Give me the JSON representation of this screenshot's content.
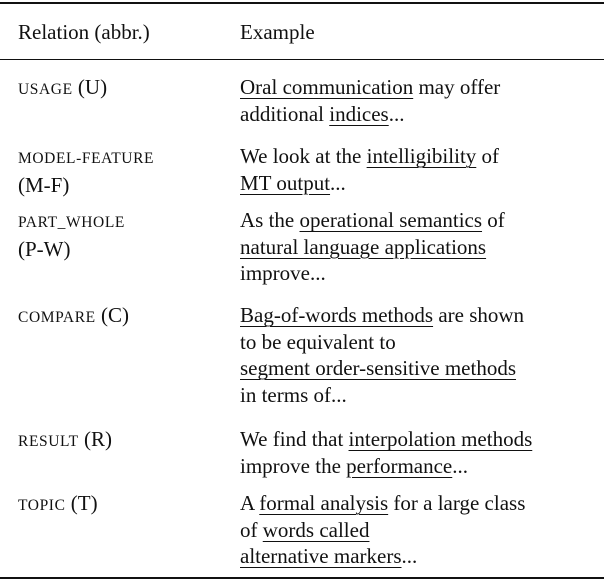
{
  "table": {
    "headers": {
      "relation": "Relation (abbr.)",
      "example": "Example"
    },
    "rows": [
      {
        "relation_name": "USAGE",
        "relation_abbr": "(U)",
        "abbr_on_new_line": false,
        "example_lines": [
          [
            {
              "text": "Oral communication",
              "underlined": true
            },
            {
              "text": " may offer",
              "underlined": false
            }
          ],
          [
            {
              "text": "additional ",
              "underlined": false
            },
            {
              "text": "indices",
              "underlined": true
            },
            {
              "text": "...",
              "underlined": false
            }
          ]
        ]
      },
      {
        "relation_name": "MODEL-FEATURE",
        "relation_abbr": "(M-F)",
        "abbr_on_new_line": true,
        "example_lines": [
          [
            {
              "text": "We look at the ",
              "underlined": false
            },
            {
              "text": "intelligibility",
              "underlined": true
            },
            {
              "text": " of",
              "underlined": false
            }
          ],
          [
            {
              "text": "MT output",
              "underlined": true
            },
            {
              "text": "...",
              "underlined": false
            }
          ]
        ]
      },
      {
        "relation_name": "PART_WHOLE",
        "relation_abbr": "(P-W)",
        "abbr_on_new_line": true,
        "example_lines": [
          [
            {
              "text": "As the ",
              "underlined": false
            },
            {
              "text": "operational semantics",
              "underlined": true
            },
            {
              "text": " of",
              "underlined": false
            }
          ],
          [
            {
              "text": "natural language applications",
              "underlined": true
            }
          ],
          [
            {
              "text": "improve...",
              "underlined": false
            }
          ]
        ]
      },
      {
        "relation_name": "COMPARE",
        "relation_abbr": "(C)",
        "abbr_on_new_line": false,
        "example_lines": [
          [
            {
              "text": "Bag-of-words methods",
              "underlined": true
            },
            {
              "text": " are shown",
              "underlined": false
            }
          ],
          [
            {
              "text": "to be equivalent to",
              "underlined": false
            }
          ],
          [
            {
              "text": "segment order-sensitive methods",
              "underlined": true
            }
          ],
          [
            {
              "text": "in terms of...",
              "underlined": false
            }
          ]
        ]
      },
      {
        "relation_name": "RESULT",
        "relation_abbr": "(R)",
        "abbr_on_new_line": false,
        "example_lines": [
          [
            {
              "text": "We find that ",
              "underlined": false
            },
            {
              "text": "interpolation methods",
              "underlined": true
            }
          ],
          [
            {
              "text": "improve the ",
              "underlined": false
            },
            {
              "text": "performance",
              "underlined": true
            },
            {
              "text": "...",
              "underlined": false
            }
          ]
        ]
      },
      {
        "relation_name": "TOPIC",
        "relation_abbr": "(T)",
        "abbr_on_new_line": false,
        "example_lines": [
          [
            {
              "text": "A ",
              "underlined": false
            },
            {
              "text": "formal analysis",
              "underlined": true
            },
            {
              "text": " for a large class",
              "underlined": false
            }
          ],
          [
            {
              "text": "of ",
              "underlined": false
            },
            {
              "text": "words called",
              "underlined": true
            }
          ],
          [
            {
              "text": "alternative markers",
              "underlined": true
            },
            {
              "text": "...",
              "underlined": false
            }
          ]
        ]
      }
    ]
  }
}
